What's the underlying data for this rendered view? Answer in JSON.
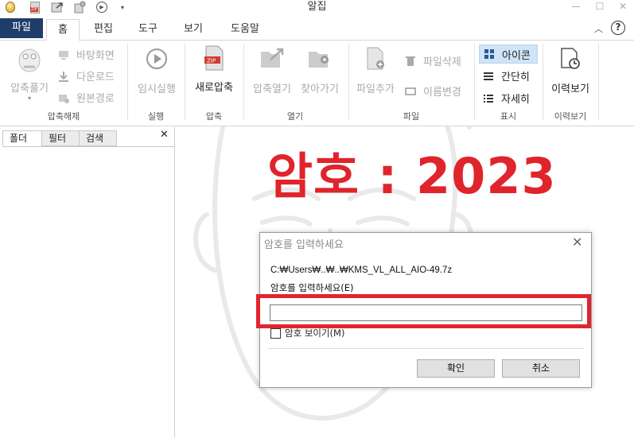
{
  "app": {
    "title": "알집"
  },
  "window_controls": {
    "minimize": "—",
    "maximize": "☐",
    "close": "✕"
  },
  "quick_access": {
    "dropdown": "▾"
  },
  "tabs": {
    "file": "파일",
    "home": "홈",
    "edit": "편집",
    "tools": "도구",
    "view": "보기",
    "help": "도움말"
  },
  "ribbon": {
    "extract": {
      "unzip_label": "압축풀기",
      "desktop_label": "바탕화면",
      "downloads_label": "다운로드",
      "original_path_label": "원본경로",
      "group_label": "압축해제"
    },
    "run": {
      "temp_run_label": "임시실행",
      "group_label": "실행"
    },
    "compress": {
      "new_zip_label": "새로압축",
      "group_label": "압축"
    },
    "open": {
      "open_zip_label": "압축열기",
      "goto_label": "찾아가기",
      "group_label": "열기"
    },
    "file": {
      "add_file_label": "파일추가",
      "delete_file_label": "파일삭제",
      "rename_label": "이름변경",
      "group_label": "파일"
    },
    "display": {
      "icon_label": "아이콘",
      "simple_label": "간단히",
      "detail_label": "자세히",
      "group_label": "표시"
    },
    "history": {
      "view_history_label": "이력보기",
      "group_label": "이력보기"
    }
  },
  "left_panel": {
    "tabs": [
      "폴더",
      "필터",
      "검색"
    ],
    "close": "✕"
  },
  "overlay": {
    "text": "암호 : 2023"
  },
  "dialog": {
    "title": "암호를 입력하세요",
    "close": "✕",
    "file_path": "C:₩Users₩..₩..₩KMS_VL_ALL_AIO-49.7z",
    "prompt": "암호를 입력하세요(E)",
    "password_value": "",
    "show_password_label": "암호 보이기(M)",
    "ok_label": "확인",
    "cancel_label": "취소"
  },
  "colors": {
    "accent_red": "#e0242c",
    "file_tab_bg": "#1f3d6a",
    "selected_bg": "#cfe4f7"
  }
}
